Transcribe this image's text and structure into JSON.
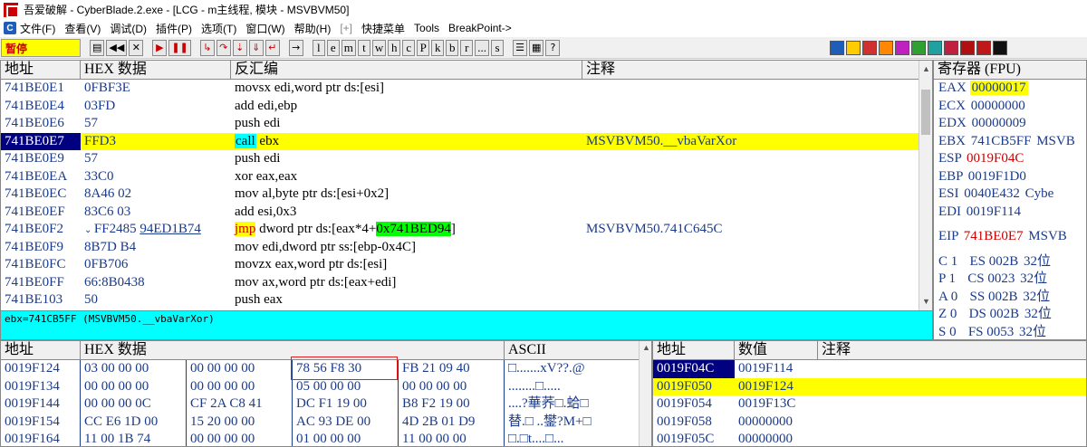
{
  "titlebar": {
    "title": "吾爱破解 - CyberBlade.2.exe - [LCG - m主线程, 模块 - MSVBVM50]"
  },
  "menubar": {
    "icon_label": "C",
    "items": [
      "文件(F)",
      "查看(V)",
      "调试(D)",
      "插件(P)",
      "选项(T)",
      "窗口(W)",
      "帮助(H)",
      "[+]",
      "快捷菜单",
      "Tools",
      "BreakPoint->"
    ]
  },
  "toolbar": {
    "status": "暂停",
    "letter_buttons": [
      "l",
      "e",
      "m",
      "t",
      "w",
      "h",
      "c",
      "P",
      "k",
      "b",
      "r",
      "...",
      "s"
    ],
    "accent": "#ffff00"
  },
  "disasm": {
    "headers": [
      "地址",
      "HEX 数据",
      "反汇编",
      "注释"
    ],
    "rows": [
      {
        "addr": "741BE0E1",
        "hex": "0FBF3E",
        "asm": "movsx edi,word ptr ds:[esi]",
        "cmt": ""
      },
      {
        "addr": "741BE0E4",
        "hex": "03FD",
        "asm": "add edi,ebp",
        "cmt": ""
      },
      {
        "addr": "741BE0E6",
        "hex": "57",
        "asm": "push edi",
        "cmt": ""
      },
      {
        "addr": "741BE0E7",
        "hex": "FFD3",
        "asm_kw": "call",
        "asm_rest": " ebx",
        "cmt": "MSVBVM50.__vbaVarXor"
      },
      {
        "addr": "741BE0E9",
        "hex": "57",
        "asm": "push edi",
        "cmt": ""
      },
      {
        "addr": "741BE0EA",
        "hex": "33C0",
        "asm": "xor eax,eax",
        "cmt": ""
      },
      {
        "addr": "741BE0EC",
        "hex": "8A46 02",
        "asm": "mov al,byte ptr ds:[esi+0x2]",
        "cmt": ""
      },
      {
        "addr": "741BE0EF",
        "hex": "83C6 03",
        "asm": "add esi,0x3",
        "cmt": ""
      },
      {
        "addr": "741BE0F2",
        "hex_pre": "FF2485 ",
        "hex_link": "94ED1B74",
        "asm_kw": "jmp",
        "asm_mid": " dword ptr ds:[eax*4+",
        "asm_hl": "0x741BED94",
        "asm_end": "]",
        "cmt": "MSVBVM50.741C645C"
      },
      {
        "addr": "741BE0F9",
        "hex": "8B7D B4",
        "asm": "mov edi,dword ptr ss:[ebp-0x4C]",
        "cmt": ""
      },
      {
        "addr": "741BE0FC",
        "hex": "0FB706",
        "asm": "movzx eax,word ptr ds:[esi]",
        "cmt": ""
      },
      {
        "addr": "741BE0FF",
        "hex": "66:8B0438",
        "asm": "mov ax,word ptr ds:[eax+edi]",
        "cmt": ""
      },
      {
        "addr": "741BE103",
        "hex": "50",
        "asm": "push eax",
        "cmt": ""
      }
    ]
  },
  "info_bar": {
    "text": "ebx=741CB5FF (MSVBVM50.__vbaVarXor)"
  },
  "registers": {
    "header": "寄存器 (FPU)",
    "lines": [
      {
        "name": "EAX",
        "value": "00000017",
        "extra": ""
      },
      {
        "name": "ECX",
        "value": "00000000",
        "extra": ""
      },
      {
        "name": "EDX",
        "value": "00000009",
        "extra": ""
      },
      {
        "name": "EBX",
        "value": "741CB5FF",
        "extra": " MSVB"
      },
      {
        "name": "ESP",
        "value": "0019F04C",
        "extra": ""
      },
      {
        "name": "EBP",
        "value": "0019F1D0",
        "extra": ""
      },
      {
        "name": "ESI",
        "value": "0040E432",
        "extra": " Cybe"
      },
      {
        "name": "EDI",
        "value": "0019F114",
        "extra": ""
      },
      {
        "name": "EIP",
        "value": "741BE0E7",
        "extra": " MSVB"
      },
      {
        "name": "C 1",
        "value": "ES 002B",
        "extra": " 32位"
      },
      {
        "name": "P 1",
        "value": "CS 0023",
        "extra": " 32位"
      },
      {
        "name": "A 0",
        "value": "SS 002B",
        "extra": " 32位"
      },
      {
        "name": "Z 0",
        "value": "DS 002B",
        "extra": " 32位"
      },
      {
        "name": "S 0",
        "value": "FS 0053",
        "extra": " 32位"
      }
    ]
  },
  "dump": {
    "headers": [
      "地址",
      "HEX 数据",
      "",
      "ASCII"
    ],
    "rows": [
      {
        "addr": "0019F124",
        "g1": "03 00 00 00",
        "g2": "00 00 00 00",
        "g3": "78 56 F8 30",
        "g4": "FB 21 09 40",
        "ascii": "□.......xV??.@"
      },
      {
        "addr": "0019F134",
        "g1": "00 00 00 00",
        "g2": "00 00 00 00",
        "g3": "05 00 00 00",
        "g4": "00 00 00 00",
        "ascii": "........□....."
      },
      {
        "addr": "0019F144",
        "g1": "00 00 00 0C",
        "g2": "CF 2A C8 41",
        "g3": "DC F1 19 00",
        "g4": "B8 F2 19 00",
        "ascii": "....?華荞□.蛤□"
      },
      {
        "addr": "0019F154",
        "g1": "CC E6 1D 00",
        "g2": "15 20 00 00",
        "g3": "AC 93 DE 00",
        "g4": "4D 2B 01 D9",
        "ascii": "替.□ ..鐢?M+□"
      },
      {
        "addr": "0019F164",
        "g1": "11 00 1B 74",
        "g2": "00 00 00 00",
        "g3": "01 00 00 00",
        "g4": "11 00 00 00",
        "ascii": "□.□t....□..."
      }
    ]
  },
  "stack": {
    "headers": [
      "地址",
      "数值",
      "注释"
    ],
    "rows": [
      {
        "addr": "0019F04C",
        "value": "0019F114",
        "cmt": ""
      },
      {
        "addr": "0019F050",
        "value": "0019F124",
        "cmt": ""
      },
      {
        "addr": "0019F054",
        "value": "0019F13C",
        "cmt": ""
      },
      {
        "addr": "0019F058",
        "value": "00000000",
        "cmt": ""
      },
      {
        "addr": "0019F05C",
        "value": "00000000",
        "cmt": ""
      }
    ]
  }
}
